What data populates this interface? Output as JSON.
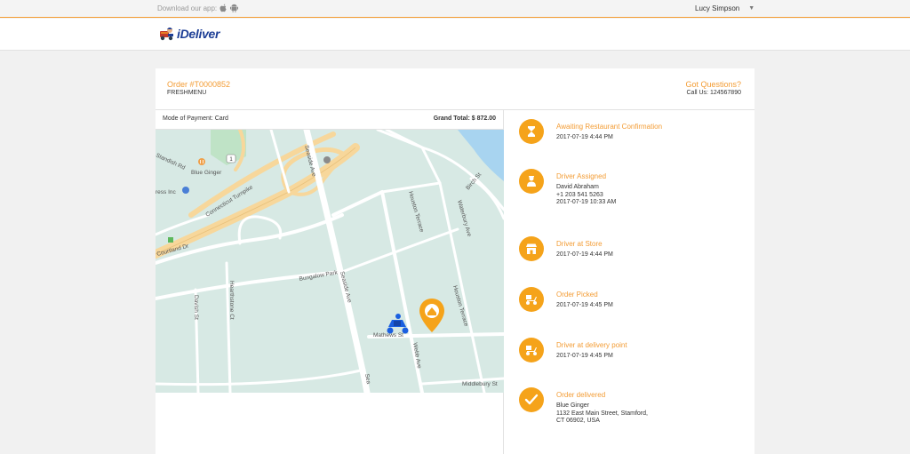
{
  "topbar": {
    "download_label": "Download our app:",
    "user_name": "Lucy Simpson"
  },
  "header": {
    "logo_text": "iDeliver"
  },
  "order": {
    "id": "Order #T0000852",
    "restaurant": "FRESHMENU",
    "questions_label": "Got Questions?",
    "call_us": "Call Us: 124567890",
    "payment": "Mode of Payment: Card",
    "grand_total_label": "Grand Total:",
    "grand_total_value": "$ 872.00"
  },
  "map": {
    "labels": {
      "standish": "Standish Rd",
      "blue_ginger": "Blue Ginger",
      "ress_inc": "ress Inc",
      "turnpike": "Connecticut Turnpike",
      "courtland": "Courtland Dr",
      "seaside": "Seaside Ave",
      "seaside2": "Seaside Ave",
      "bungalow": "Bungalow Park",
      "hearthstone": "Hearthstone Ct",
      "davish": "Davish St",
      "houston": "Houston Terrace",
      "houston2": "Houston Terrace",
      "waterbury": "Waterbury Ave",
      "birch": "Birch St",
      "mathews": "Mathews St",
      "webb": "Webb Ave",
      "middlebury": "Middlebury St",
      "sea": "Sea"
    },
    "route_shield": "1",
    "colors": {
      "water": "#a8d4f0",
      "park": "#bfe3c6",
      "highway": "#f7d79b",
      "pin": "#f5a31a",
      "driver": "#1a5fe0"
    }
  },
  "timeline": [
    {
      "title": "Awaiting Restaurant Confirmation",
      "lines": [
        "2017-07-19 4:44 PM"
      ],
      "icon": "hourglass-icon"
    },
    {
      "title": "Driver Assigned",
      "lines": [
        "David Abraham",
        "+1 203 541 5263",
        "2017-07-19 10:33 AM"
      ],
      "icon": "driver-icon"
    },
    {
      "title": "Driver at Store",
      "lines": [
        "2017-07-19 4:44 PM"
      ],
      "icon": "store-icon"
    },
    {
      "title": "Order Picked",
      "lines": [
        "2017-07-19 4:45 PM"
      ],
      "icon": "scooter-icon"
    },
    {
      "title": "Driver at delivery point",
      "lines": [
        "2017-07-19 4:45 PM"
      ],
      "icon": "scooter-icon"
    },
    {
      "title": "Order delivered",
      "lines": [
        "Blue Ginger",
        "1132 East Main Street, Stamford,",
        "CT 06902, USA"
      ],
      "icon": "checkmark-icon"
    }
  ]
}
